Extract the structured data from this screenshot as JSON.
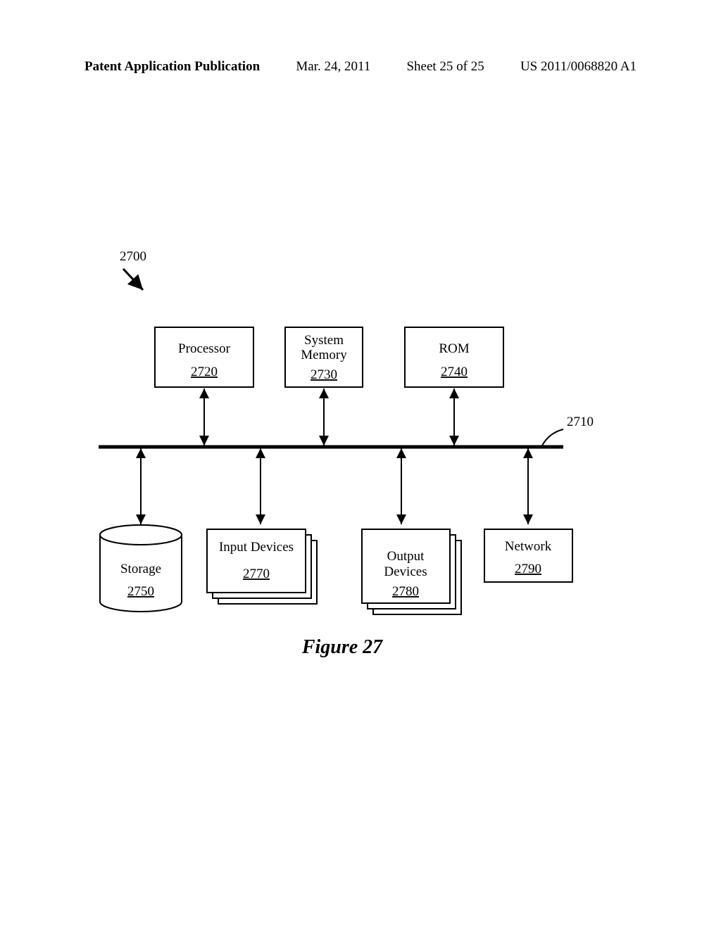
{
  "header": {
    "left": "Patent Application Publication",
    "date": "Mar. 24, 2011",
    "sheet": "Sheet 25 of 25",
    "docnum": "US 2011/0068820 A1"
  },
  "diagram": {
    "ref_system": "2700",
    "bus_ref": "2710",
    "top": [
      {
        "label": "Processor",
        "num": "2720"
      },
      {
        "label1": "System",
        "label2": "Memory",
        "num": "2730"
      },
      {
        "label": "ROM",
        "num": "2740"
      }
    ],
    "bottom": {
      "storage": {
        "label": "Storage",
        "num": "2750"
      },
      "input": {
        "label": "Input Devices",
        "num": "2770"
      },
      "output": {
        "label1": "Output",
        "label2": "Devices",
        "num": "2780"
      },
      "network": {
        "label": "Network",
        "num": "2790"
      }
    },
    "caption": "Figure 27"
  }
}
